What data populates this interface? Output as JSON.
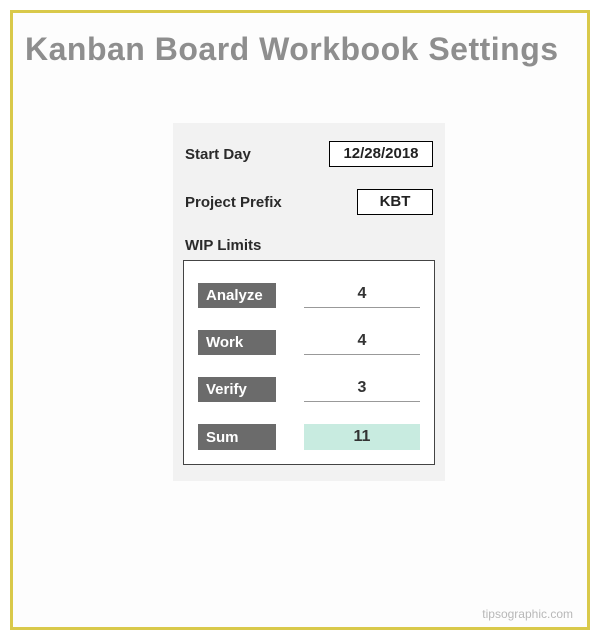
{
  "title": "Kanban Board Workbook Settings",
  "fields": {
    "start_day": {
      "label": "Start Day",
      "value": "12/28/2018"
    },
    "project_prefix": {
      "label": "Project Prefix",
      "value": "KBT"
    }
  },
  "wip": {
    "section_label": "WIP Limits",
    "rows": [
      {
        "name": "Analyze",
        "value": "4"
      },
      {
        "name": "Work",
        "value": "4"
      },
      {
        "name": "Verify",
        "value": "3"
      }
    ],
    "sum": {
      "name": "Sum",
      "value": "11"
    }
  },
  "footer": {
    "right": "tipsographic.com"
  }
}
